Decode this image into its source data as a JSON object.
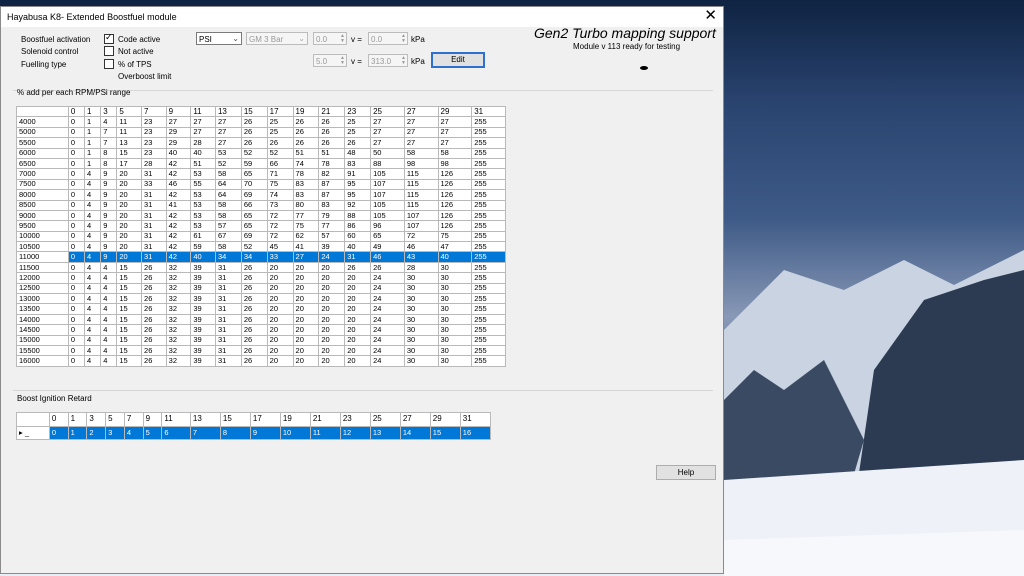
{
  "window": {
    "title": "Hayabusa K8- Extended Boostfuel module"
  },
  "labels": {
    "boostfuel_activation": "Boostfuel activation",
    "solenoid_control": "Solenoid control",
    "fuelling_type": "Fuelling type",
    "overboost_limit": "Overboost limit",
    "v_eq": "v =",
    "kpa": "kPa"
  },
  "checkboxes": {
    "code_active": {
      "label": "Code active",
      "checked": true
    },
    "not_active": {
      "label": "Not active",
      "checked": false
    },
    "pct_tps": {
      "label": "% of TPS",
      "checked": false
    }
  },
  "controls": {
    "unit_select": "PSI",
    "sensor_select": "GM 3 Bar",
    "spin1": "0.0",
    "spin1_kpa": "0.0",
    "spin2": "5.0",
    "spin2_kpa": "313.0",
    "edit_label": "Edit",
    "help_label": "Help"
  },
  "header": {
    "brand": "Gen2 Turbo mapping support",
    "module_line": "Module  v  113  ready for testing"
  },
  "boost_section": {
    "title": "% add per each RPM/PSi range",
    "columns": [
      "0",
      "1",
      "3",
      "5",
      "7",
      "9",
      "11",
      "13",
      "15",
      "17",
      "19",
      "21",
      "23",
      "25",
      "27",
      "29",
      "31"
    ],
    "selected_row": 10,
    "rows": [
      {
        "rpm": "4000",
        "v": [
          "0",
          "1",
          "4",
          "11",
          "23",
          "27",
          "27",
          "27",
          "26",
          "25",
          "26",
          "26",
          "25",
          "27",
          "27",
          "27",
          "255"
        ]
      },
      {
        "rpm": "5000",
        "v": [
          "0",
          "1",
          "7",
          "11",
          "23",
          "29",
          "27",
          "27",
          "26",
          "25",
          "26",
          "26",
          "25",
          "27",
          "27",
          "27",
          "255"
        ]
      },
      {
        "rpm": "5500",
        "v": [
          "0",
          "1",
          "7",
          "13",
          "23",
          "29",
          "28",
          "27",
          "26",
          "26",
          "26",
          "26",
          "26",
          "27",
          "27",
          "27",
          "255"
        ]
      },
      {
        "rpm": "6000",
        "v": [
          "0",
          "1",
          "8",
          "15",
          "23",
          "40",
          "40",
          "53",
          "52",
          "52",
          "51",
          "51",
          "48",
          "50",
          "58",
          "58",
          "255"
        ]
      },
      {
        "rpm": "6500",
        "v": [
          "0",
          "1",
          "8",
          "17",
          "28",
          "42",
          "51",
          "52",
          "59",
          "66",
          "74",
          "78",
          "83",
          "88",
          "98",
          "98",
          "255"
        ]
      },
      {
        "rpm": "7000",
        "v": [
          "0",
          "4",
          "9",
          "20",
          "31",
          "42",
          "53",
          "58",
          "65",
          "71",
          "78",
          "82",
          "91",
          "105",
          "115",
          "126",
          "255"
        ]
      },
      {
        "rpm": "7500",
        "v": [
          "0",
          "4",
          "9",
          "20",
          "33",
          "46",
          "55",
          "64",
          "70",
          "75",
          "83",
          "87",
          "95",
          "107",
          "115",
          "126",
          "255"
        ]
      },
      {
        "rpm": "8000",
        "v": [
          "0",
          "4",
          "9",
          "20",
          "31",
          "42",
          "53",
          "64",
          "69",
          "74",
          "83",
          "87",
          "95",
          "107",
          "115",
          "126",
          "255"
        ]
      },
      {
        "rpm": "8500",
        "v": [
          "0",
          "4",
          "9",
          "20",
          "31",
          "41",
          "53",
          "58",
          "66",
          "73",
          "80",
          "83",
          "92",
          "105",
          "115",
          "126",
          "255"
        ]
      },
      {
        "rpm": "9000",
        "v": [
          "0",
          "4",
          "9",
          "20",
          "31",
          "42",
          "53",
          "58",
          "65",
          "72",
          "77",
          "79",
          "88",
          "105",
          "107",
          "126",
          "255"
        ]
      },
      {
        "rpm": "9500",
        "v": [
          "0",
          "4",
          "9",
          "20",
          "31",
          "42",
          "53",
          "57",
          "65",
          "72",
          "75",
          "77",
          "86",
          "96",
          "107",
          "126",
          "255"
        ]
      },
      {
        "rpm": "10000",
        "v": [
          "0",
          "4",
          "9",
          "20",
          "31",
          "42",
          "61",
          "67",
          "69",
          "72",
          "62",
          "57",
          "60",
          "65",
          "72",
          "75",
          "255"
        ]
      },
      {
        "rpm": "10500",
        "v": [
          "0",
          "4",
          "9",
          "20",
          "31",
          "42",
          "59",
          "58",
          "52",
          "45",
          "41",
          "39",
          "40",
          "49",
          "46",
          "47",
          "255"
        ]
      },
      {
        "rpm": "11000",
        "v": [
          "0",
          "4",
          "9",
          "20",
          "31",
          "42",
          "40",
          "34",
          "34",
          "33",
          "27",
          "24",
          "31",
          "46",
          "43",
          "40",
          "255"
        ]
      },
      {
        "rpm": "11500",
        "v": [
          "0",
          "4",
          "4",
          "15",
          "26",
          "32",
          "39",
          "31",
          "26",
          "20",
          "20",
          "20",
          "26",
          "26",
          "28",
          "30",
          "255"
        ]
      },
      {
        "rpm": "12000",
        "v": [
          "0",
          "4",
          "4",
          "15",
          "26",
          "32",
          "39",
          "31",
          "26",
          "20",
          "20",
          "20",
          "20",
          "24",
          "30",
          "30",
          "255"
        ]
      },
      {
        "rpm": "12500",
        "v": [
          "0",
          "4",
          "4",
          "15",
          "26",
          "32",
          "39",
          "31",
          "26",
          "20",
          "20",
          "20",
          "20",
          "24",
          "30",
          "30",
          "255"
        ]
      },
      {
        "rpm": "13000",
        "v": [
          "0",
          "4",
          "4",
          "15",
          "26",
          "32",
          "39",
          "31",
          "26",
          "20",
          "20",
          "20",
          "20",
          "24",
          "30",
          "30",
          "255"
        ]
      },
      {
        "rpm": "13500",
        "v": [
          "0",
          "4",
          "4",
          "15",
          "26",
          "32",
          "39",
          "31",
          "26",
          "20",
          "20",
          "20",
          "20",
          "24",
          "30",
          "30",
          "255"
        ]
      },
      {
        "rpm": "14000",
        "v": [
          "0",
          "4",
          "4",
          "15",
          "26",
          "32",
          "39",
          "31",
          "26",
          "20",
          "20",
          "20",
          "20",
          "24",
          "30",
          "30",
          "255"
        ]
      },
      {
        "rpm": "14500",
        "v": [
          "0",
          "4",
          "4",
          "15",
          "26",
          "32",
          "39",
          "31",
          "26",
          "20",
          "20",
          "20",
          "20",
          "24",
          "30",
          "30",
          "255"
        ]
      },
      {
        "rpm": "15000",
        "v": [
          "0",
          "4",
          "4",
          "15",
          "26",
          "32",
          "39",
          "31",
          "26",
          "20",
          "20",
          "20",
          "20",
          "24",
          "30",
          "30",
          "255"
        ]
      },
      {
        "rpm": "15500",
        "v": [
          "0",
          "4",
          "4",
          "15",
          "26",
          "32",
          "39",
          "31",
          "26",
          "20",
          "20",
          "20",
          "20",
          "24",
          "30",
          "30",
          "255"
        ]
      },
      {
        "rpm": "16000",
        "v": [
          "0",
          "4",
          "4",
          "15",
          "26",
          "32",
          "39",
          "31",
          "26",
          "20",
          "20",
          "20",
          "20",
          "24",
          "30",
          "30",
          "255"
        ]
      }
    ]
  },
  "ignition_section": {
    "title": "Boost Ignition Retard",
    "columns": [
      "0",
      "1",
      "3",
      "5",
      "7",
      "9",
      "11",
      "13",
      "15",
      "17",
      "19",
      "21",
      "23",
      "25",
      "27",
      "29",
      "31"
    ],
    "row_marker": "▸ _",
    "values": [
      "0",
      "1",
      "2",
      "3",
      "4",
      "5",
      "6",
      "7",
      "8",
      "9",
      "10",
      "11",
      "12",
      "13",
      "14",
      "15",
      "16"
    ]
  }
}
